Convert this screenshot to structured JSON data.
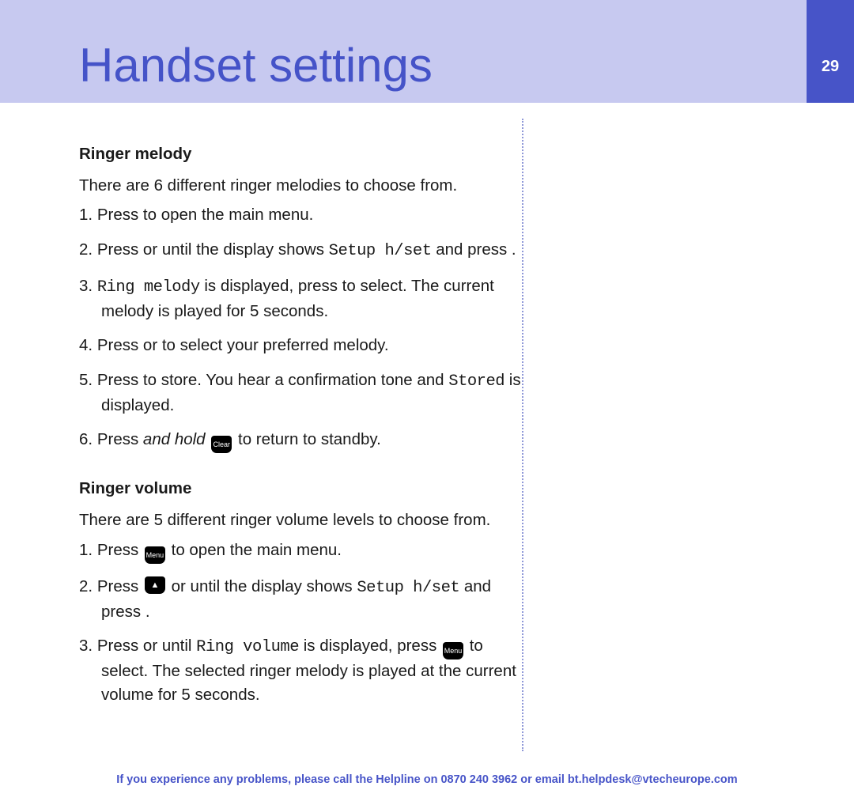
{
  "header": {
    "title": "Handset settings",
    "page_number": "29"
  },
  "melody": {
    "heading": "Ringer melody",
    "intro": "There are 6 different ringer melodies to choose from.",
    "step1_a": "Press ",
    "step1_b": " to open the main menu.",
    "step2_a": "Press ",
    "step2_b": " or ",
    "step2_c": " until the display shows ",
    "step2_lcd": "Setup h/set",
    "step2_d": " and press ",
    "step2_e": ".",
    "step3_lcd": "Ring melody",
    "step3_a": " is displayed, press ",
    "step3_b": " to select. The current melody is played for 5 seconds.",
    "step4_a": "Press ",
    "step4_b": " or ",
    "step4_c": " to select your preferred melody.",
    "step5_a": "Press ",
    "step5_b": " to store. You hear a confirmation tone and ",
    "step5_lcd": "Stored",
    "step5_c": " is displayed.",
    "step6_a": "Press ",
    "step6_em": "and hold",
    "step6_key": "Clear",
    "step6_b": " to return to standby."
  },
  "volume": {
    "heading": "Ringer volume",
    "intro": "There are 5 different ringer volume levels to choose from.",
    "step1_a": "Press ",
    "step1_key": "Menu",
    "step1_b": " to open the main menu.",
    "step2_a": "Press ",
    "step2_b": " or ",
    "step2_c": " until the display shows ",
    "step2_lcd": "Setup h/set",
    "step2_d": " and press ",
    "step2_e": ".",
    "step3_a": "Press ",
    "step3_b": " or ",
    "step3_c": " until ",
    "step3_lcd": "Ring volume",
    "step3_d": " is displayed, press ",
    "step3_key": "Menu",
    "step3_e": " to select. The selected ringer melody is played at the current volume for 5 seconds."
  },
  "footer": {
    "pre": "If you experience any problems, please call the Helpline on ",
    "phone": "0870 240 3962",
    "mid": " or email ",
    "email": "bt.helpdesk@vtecheurope.com"
  }
}
